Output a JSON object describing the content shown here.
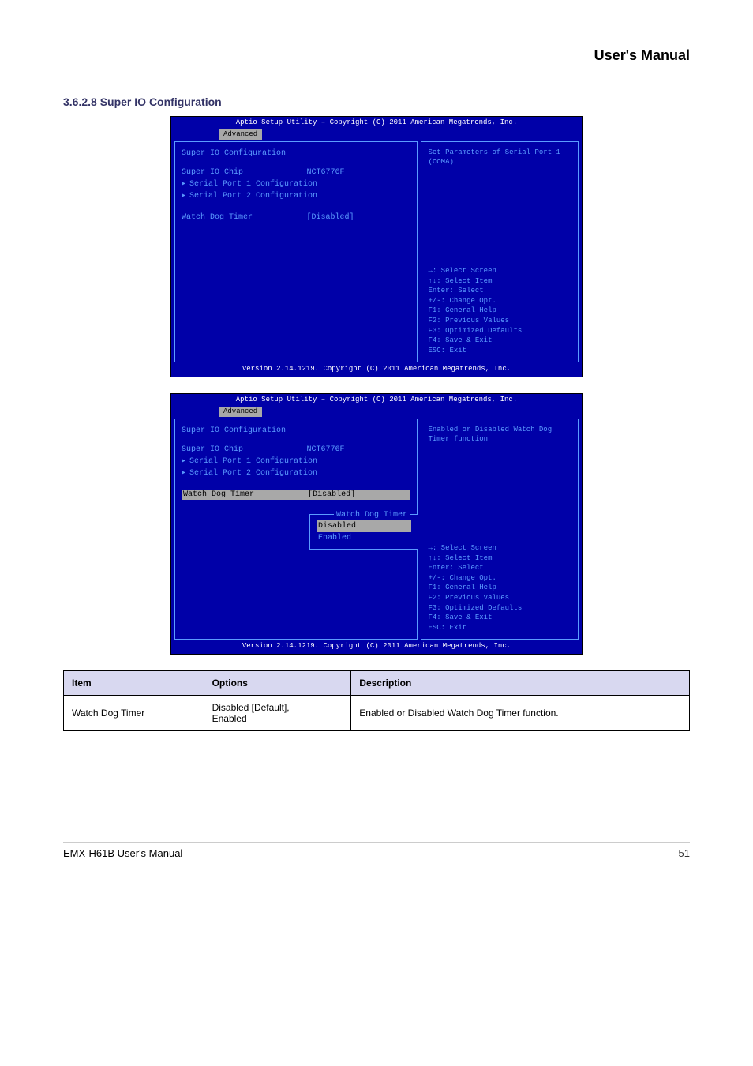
{
  "header": {
    "title": "User's Manual"
  },
  "section_title": "3.6.2.8 Super IO Configuration",
  "bios1": {
    "top": "Aptio Setup Utility – Copyright (C) 2011 American Megatrends, Inc.",
    "tab": "Advanced",
    "heading": "Super IO Configuration",
    "rows": {
      "chip_label": "Super IO Chip",
      "chip_value": "NCT6776F",
      "sp1": "Serial Port 1 Configuration",
      "sp2": "Serial Port 2 Configuration",
      "wdt_label": "Watch Dog Timer",
      "wdt_value": "[Disabled]"
    },
    "help": "Set Parameters of Serial Port 1 (COMA)",
    "keys": {
      "k1": "↔: Select Screen",
      "k2": "↑↓: Select Item",
      "k3": "Enter: Select",
      "k4": "+/-: Change Opt.",
      "k5": "F1: General Help",
      "k6": "F2: Previous Values",
      "k7": "F3: Optimized Defaults",
      "k8": "F4: Save & Exit",
      "k9": "ESC: Exit"
    },
    "footer": "Version 2.14.1219. Copyright (C) 2011 American Megatrends, Inc."
  },
  "bios2": {
    "top": "Aptio Setup Utility – Copyright (C) 2011 American Megatrends, Inc.",
    "tab": "Advanced",
    "heading": "Super IO Configuration",
    "rows": {
      "chip_label": "Super IO Chip",
      "chip_value": "NCT6776F",
      "sp1": "Serial Port 1 Configuration",
      "sp2": "Serial Port 2 Configuration",
      "wdt_label": "Watch Dog Timer",
      "wdt_value": "[Disabled]"
    },
    "popup": {
      "title": "Watch Dog Timer",
      "opt1": "Disabled",
      "opt2": "Enabled"
    },
    "help": "Enabled or Disabled Watch Dog Timer function",
    "keys": {
      "k1": "↔: Select Screen",
      "k2": "↑↓: Select Item",
      "k3": "Enter: Select",
      "k4": "+/-: Change Opt.",
      "k5": "F1: General Help",
      "k6": "F2: Previous Values",
      "k7": "F3: Optimized Defaults",
      "k8": "F4: Save & Exit",
      "k9": "ESC: Exit"
    },
    "footer": "Version 2.14.1219. Copyright (C) 2011 American Megatrends, Inc."
  },
  "table": {
    "h1": "Item",
    "h2": "Options",
    "h3": "Description",
    "r1c1": "Watch Dog Timer",
    "r1c2": "Disabled [Default],\nEnabled",
    "r1c3": "Enabled or Disabled Watch Dog Timer function."
  },
  "footer": {
    "label": "EMX-H61B User's Manual",
    "page": "51"
  }
}
